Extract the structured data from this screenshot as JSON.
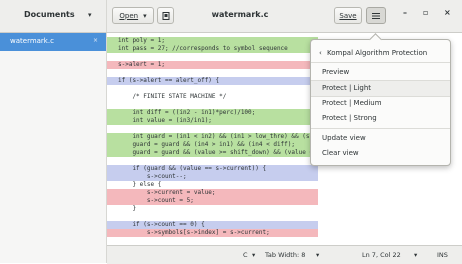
{
  "header": {
    "sidebar_title": "Documents",
    "open_label": "Open",
    "doc_title": "watermark.c",
    "save_label": "Save",
    "minimize": "–",
    "maximize": "▫",
    "close": "×"
  },
  "sidebar": {
    "items": [
      {
        "label": "watermark.c",
        "close": "×"
      }
    ]
  },
  "editor": {
    "lines": [
      {
        "text": "int poly = 1;",
        "hl": "green"
      },
      {
        "text": "int pass = 27; //corresponds to symbol sequence",
        "hl": "green"
      },
      {
        "text": "",
        "hl": ""
      },
      {
        "text": "s->alert = 1;",
        "hl": "red"
      },
      {
        "text": "",
        "hl": ""
      },
      {
        "text": "if (s->alert == alert_off) {",
        "hl": "blue"
      },
      {
        "text": "",
        "hl": ""
      },
      {
        "text": "    /* FINITE STATE MACHINE */",
        "hl": ""
      },
      {
        "text": "",
        "hl": ""
      },
      {
        "text": "    int diff = ((in2 - in1)*perc)/100;",
        "hl": "green"
      },
      {
        "text": "    int value = (in3/in1);",
        "hl": "green"
      },
      {
        "text": "",
        "hl": ""
      },
      {
        "text": "    int guard = (in1 < in2) && (in1 > low_thre) && (s->count > 0);",
        "hl": "green"
      },
      {
        "text": "    guard = guard && (in4 > in1) && (in4 < diff);",
        "hl": "green"
      },
      {
        "text": "    guard = guard && (value >= shift_down) && (value <= shift_up);",
        "hl": "green"
      },
      {
        "text": "",
        "hl": ""
      },
      {
        "text": "    if (guard && (value == s->current)) {",
        "hl": "blue"
      },
      {
        "text": "        s->count--;",
        "hl": "blue"
      },
      {
        "text": "    } else {",
        "hl": ""
      },
      {
        "text": "        s->current = value;",
        "hl": "red"
      },
      {
        "text": "        s->count = 5;",
        "hl": "red"
      },
      {
        "text": "    }",
        "hl": ""
      },
      {
        "text": "",
        "hl": ""
      },
      {
        "text": "    if (s->count == 0) {",
        "hl": "blue"
      },
      {
        "text": "        s->symbols[s->index] = s->current;",
        "hl": "red"
      }
    ]
  },
  "popover": {
    "header": "Kompal Algorithm Protection",
    "items": [
      {
        "label": "Preview"
      },
      {
        "label": "Protect | Light"
      },
      {
        "label": "Protect | Medium"
      },
      {
        "label": "Protect | Strong"
      },
      {
        "label": "Update view"
      },
      {
        "label": "Clear view"
      }
    ]
  },
  "statusbar": {
    "language": "C",
    "tab_width": "Tab Width: 8",
    "position": "Ln 7, Col 22",
    "mode": "INS"
  }
}
